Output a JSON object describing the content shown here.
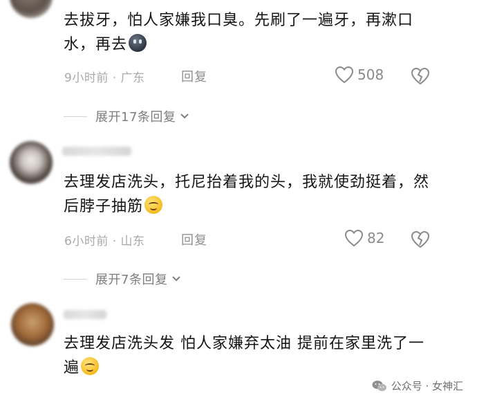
{
  "comments": [
    {
      "text": "去拔牙，怕人家嫌我口臭。先刷了一遍牙，再漱口水，再去",
      "time_location": "9小时前 · 广东",
      "reply_label": "回复",
      "likes": "508",
      "expand_label": "展开17条回复"
    },
    {
      "text": "去理发店洗头，托尼抬着我的头，我就使劲挺着，然后脖子抽筋",
      "time_location": "6小时前 · 山东",
      "reply_label": "回复",
      "likes": "82",
      "expand_label": "展开7条回复"
    },
    {
      "text": "去理发店洗头发 怕人家嫌弃太油 提前在家里洗了一遍"
    }
  ],
  "watermark": {
    "text": "公众号 · 女神汇",
    "icon": "wechat-icon"
  },
  "icons": {
    "like": "heart-icon",
    "dislike": "broken-heart-icon",
    "expand": "chevron-down-icon"
  }
}
